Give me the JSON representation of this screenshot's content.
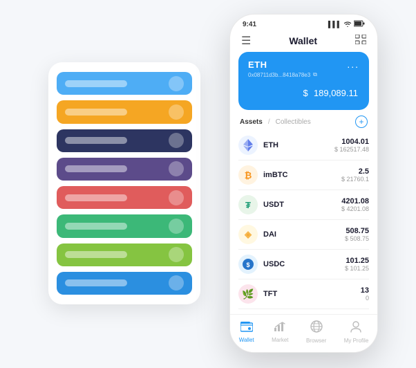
{
  "page": {
    "bg": "#f5f7fa"
  },
  "background_card": {
    "bars": [
      {
        "color": "#4EADF5",
        "id": "blue-1"
      },
      {
        "color": "#F5A623",
        "id": "orange"
      },
      {
        "color": "#2D3561",
        "id": "dark-blue"
      },
      {
        "color": "#5C4B8A",
        "id": "purple"
      },
      {
        "color": "#E05C5C",
        "id": "red"
      },
      {
        "color": "#3CB878",
        "id": "green-1"
      },
      {
        "color": "#85C441",
        "id": "light-green"
      },
      {
        "color": "#2B8FE0",
        "id": "blue-2"
      }
    ]
  },
  "phone": {
    "status_bar": {
      "time": "9:41",
      "signal": "▌▌▌",
      "wifi": "WiFi",
      "battery": "🔋"
    },
    "nav": {
      "menu_icon": "☰",
      "title": "Wallet",
      "expand_icon": "⛶"
    },
    "eth_card": {
      "title": "ETH",
      "address": "0x08711d3b...8418a78e3",
      "copy_icon": "⧉",
      "menu": "...",
      "currency": "$",
      "amount": "189,089.11"
    },
    "assets_section": {
      "tab_active": "Assets",
      "tab_divider": "/",
      "tab_inactive": "Collectibles",
      "add_icon": "+"
    },
    "assets": [
      {
        "symbol": "ETH",
        "icon_char": "Ξ",
        "icon_class": "eth-icon",
        "icon_color": "#627EEA",
        "amount": "1004.01",
        "usd": "$ 162517.48"
      },
      {
        "symbol": "imBTC",
        "icon_char": "₿",
        "icon_class": "imbtc-icon",
        "icon_color": "#F7931A",
        "amount": "2.5",
        "usd": "$ 21760.1"
      },
      {
        "symbol": "USDT",
        "icon_char": "₮",
        "icon_class": "usdt-icon",
        "icon_color": "#26A17B",
        "amount": "4201.08",
        "usd": "$ 4201.08"
      },
      {
        "symbol": "DAI",
        "icon_char": "◈",
        "icon_class": "dai-icon",
        "icon_color": "#F5AC37",
        "amount": "508.75",
        "usd": "$ 508.75"
      },
      {
        "symbol": "USDC",
        "icon_char": "©",
        "icon_class": "usdc-icon",
        "icon_color": "#2775CA",
        "amount": "101.25",
        "usd": "$ 101.25"
      },
      {
        "symbol": "TFT",
        "icon_char": "🌿",
        "icon_class": "tft-icon",
        "icon_color": "#e91e63",
        "amount": "13",
        "usd": "0"
      }
    ],
    "bottom_nav": [
      {
        "label": "Wallet",
        "icon": "👛",
        "active": true
      },
      {
        "label": "Market",
        "icon": "📈",
        "active": false
      },
      {
        "label": "Browser",
        "icon": "👤",
        "active": false
      },
      {
        "label": "My Profile",
        "icon": "👤",
        "active": false
      }
    ]
  }
}
